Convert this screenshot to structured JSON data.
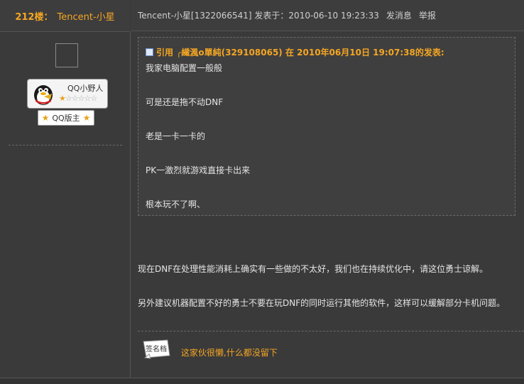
{
  "post": {
    "floor": "212楼：",
    "author": "Tencent-小星",
    "meta_prefix": "Tencent-小星[1322066541] 发表于：2010-06-10 19:23:33",
    "send_message": "发消息",
    "report": "举报"
  },
  "user": {
    "rank_name": "QQ小野人",
    "stars_filled": 1,
    "stars_total": 6,
    "stars_on": "★",
    "stars_off": "☆☆☆☆☆",
    "admin_label": "QQ版主"
  },
  "quote": {
    "label": "引用",
    "header": "╭繊渢o單純(329108065) 在 2010年06月10日 19:07:38的发表:",
    "lines": [
      "我家电脑配置一般般",
      "可是还是拖不动DNF",
      "老是一卡一卡的",
      "PK一激烈就游戏直接卡出来",
      "根本玩不了啊、"
    ]
  },
  "reply": {
    "lines": [
      "现在DNF在处理性能消耗上确实有一些做的不太好，我们也在持续优化中，请这位勇士谅解。",
      "另外建议机器配置不好的勇士不要在玩DNF的同时运行其他的软件，这样可以缓解部分卡机问题。"
    ]
  },
  "signature": {
    "badge_label": "签名档",
    "text": "这家伙很懒,什么都没留下"
  },
  "colors": {
    "accent": "#f5a623",
    "background": "#3a3a3a"
  }
}
